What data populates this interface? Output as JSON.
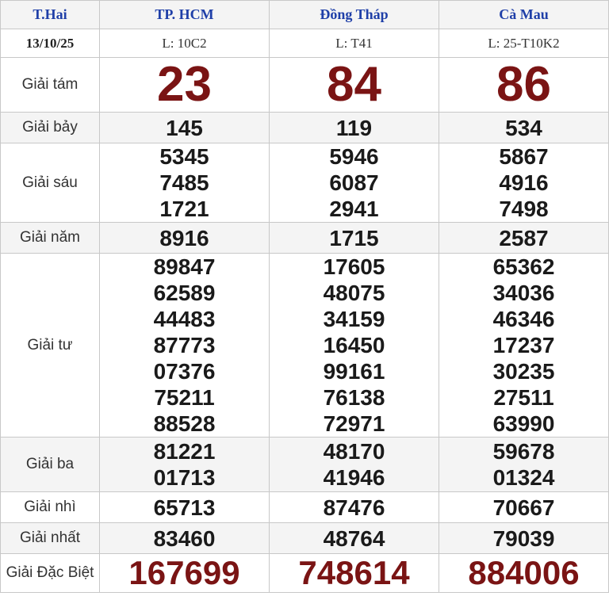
{
  "header": {
    "day": "T.Hai",
    "provinces": [
      "TP. HCM",
      "Đồng Tháp",
      "Cà Mau"
    ]
  },
  "subheader": {
    "date": "13/10/25",
    "codes": [
      "L: 10C2",
      "L: T41",
      "L: 25-T10K2"
    ]
  },
  "prizes": {
    "g8": {
      "label": "Giải tám",
      "values": [
        "23",
        "84",
        "86"
      ]
    },
    "g7": {
      "label": "Giải bảy",
      "values": [
        "145",
        "119",
        "534"
      ]
    },
    "g6": {
      "label": "Giải sáu",
      "values": [
        [
          "5345",
          "7485",
          "1721"
        ],
        [
          "5946",
          "6087",
          "2941"
        ],
        [
          "5867",
          "4916",
          "7498"
        ]
      ]
    },
    "g5": {
      "label": "Giải năm",
      "values": [
        "8916",
        "1715",
        "2587"
      ]
    },
    "g4": {
      "label": "Giải tư",
      "values": [
        [
          "89847",
          "62589",
          "44483",
          "87773",
          "07376",
          "75211",
          "88528"
        ],
        [
          "17605",
          "48075",
          "34159",
          "16450",
          "99161",
          "76138",
          "72971"
        ],
        [
          "65362",
          "34036",
          "46346",
          "17237",
          "30235",
          "27511",
          "63990"
        ]
      ]
    },
    "g3": {
      "label": "Giải ba",
      "values": [
        [
          "81221",
          "01713"
        ],
        [
          "48170",
          "41946"
        ],
        [
          "59678",
          "01324"
        ]
      ]
    },
    "g2": {
      "label": "Giải nhì",
      "values": [
        "65713",
        "87476",
        "70667"
      ]
    },
    "g1": {
      "label": "Giải nhất",
      "values": [
        "83460",
        "48764",
        "79039"
      ]
    },
    "db": {
      "label": "Giải Đặc Biệt",
      "values": [
        "167699",
        "748614",
        "884006"
      ]
    }
  },
  "colors": {
    "header_text": "#1f3fa8",
    "highlight": "#7a1414",
    "alt_row": "#f4f4f4",
    "border": "#c8c8c8"
  }
}
